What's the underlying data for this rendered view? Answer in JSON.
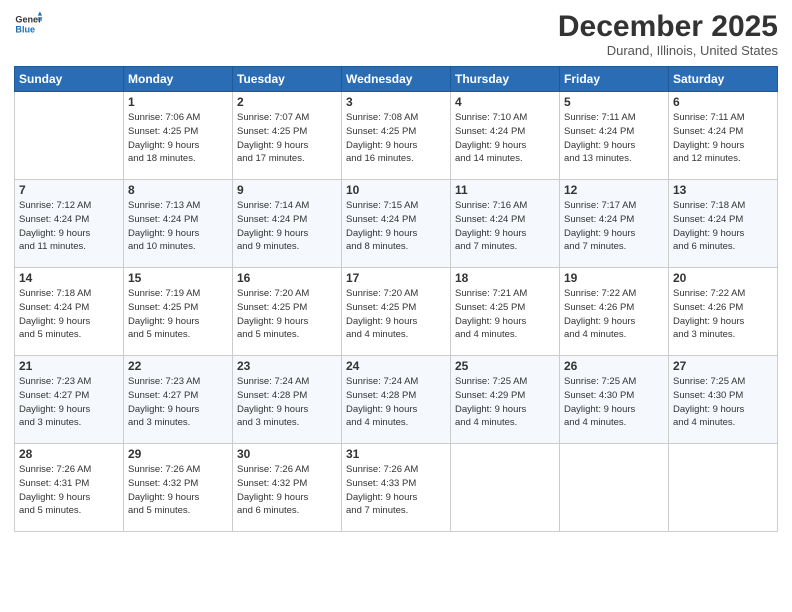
{
  "logo": {
    "general": "General",
    "blue": "Blue"
  },
  "header": {
    "title": "December 2025",
    "location": "Durand, Illinois, United States"
  },
  "weekdays": [
    "Sunday",
    "Monday",
    "Tuesday",
    "Wednesday",
    "Thursday",
    "Friday",
    "Saturday"
  ],
  "weeks": [
    [
      {
        "day": "",
        "info": ""
      },
      {
        "day": "1",
        "info": "Sunrise: 7:06 AM\nSunset: 4:25 PM\nDaylight: 9 hours\nand 18 minutes."
      },
      {
        "day": "2",
        "info": "Sunrise: 7:07 AM\nSunset: 4:25 PM\nDaylight: 9 hours\nand 17 minutes."
      },
      {
        "day": "3",
        "info": "Sunrise: 7:08 AM\nSunset: 4:25 PM\nDaylight: 9 hours\nand 16 minutes."
      },
      {
        "day": "4",
        "info": "Sunrise: 7:10 AM\nSunset: 4:24 PM\nDaylight: 9 hours\nand 14 minutes."
      },
      {
        "day": "5",
        "info": "Sunrise: 7:11 AM\nSunset: 4:24 PM\nDaylight: 9 hours\nand 13 minutes."
      },
      {
        "day": "6",
        "info": "Sunrise: 7:11 AM\nSunset: 4:24 PM\nDaylight: 9 hours\nand 12 minutes."
      }
    ],
    [
      {
        "day": "7",
        "info": "Sunrise: 7:12 AM\nSunset: 4:24 PM\nDaylight: 9 hours\nand 11 minutes."
      },
      {
        "day": "8",
        "info": "Sunrise: 7:13 AM\nSunset: 4:24 PM\nDaylight: 9 hours\nand 10 minutes."
      },
      {
        "day": "9",
        "info": "Sunrise: 7:14 AM\nSunset: 4:24 PM\nDaylight: 9 hours\nand 9 minutes."
      },
      {
        "day": "10",
        "info": "Sunrise: 7:15 AM\nSunset: 4:24 PM\nDaylight: 9 hours\nand 8 minutes."
      },
      {
        "day": "11",
        "info": "Sunrise: 7:16 AM\nSunset: 4:24 PM\nDaylight: 9 hours\nand 7 minutes."
      },
      {
        "day": "12",
        "info": "Sunrise: 7:17 AM\nSunset: 4:24 PM\nDaylight: 9 hours\nand 7 minutes."
      },
      {
        "day": "13",
        "info": "Sunrise: 7:18 AM\nSunset: 4:24 PM\nDaylight: 9 hours\nand 6 minutes."
      }
    ],
    [
      {
        "day": "14",
        "info": "Sunrise: 7:18 AM\nSunset: 4:24 PM\nDaylight: 9 hours\nand 5 minutes."
      },
      {
        "day": "15",
        "info": "Sunrise: 7:19 AM\nSunset: 4:25 PM\nDaylight: 9 hours\nand 5 minutes."
      },
      {
        "day": "16",
        "info": "Sunrise: 7:20 AM\nSunset: 4:25 PM\nDaylight: 9 hours\nand 5 minutes."
      },
      {
        "day": "17",
        "info": "Sunrise: 7:20 AM\nSunset: 4:25 PM\nDaylight: 9 hours\nand 4 minutes."
      },
      {
        "day": "18",
        "info": "Sunrise: 7:21 AM\nSunset: 4:25 PM\nDaylight: 9 hours\nand 4 minutes."
      },
      {
        "day": "19",
        "info": "Sunrise: 7:22 AM\nSunset: 4:26 PM\nDaylight: 9 hours\nand 4 minutes."
      },
      {
        "day": "20",
        "info": "Sunrise: 7:22 AM\nSunset: 4:26 PM\nDaylight: 9 hours\nand 3 minutes."
      }
    ],
    [
      {
        "day": "21",
        "info": "Sunrise: 7:23 AM\nSunset: 4:27 PM\nDaylight: 9 hours\nand 3 minutes."
      },
      {
        "day": "22",
        "info": "Sunrise: 7:23 AM\nSunset: 4:27 PM\nDaylight: 9 hours\nand 3 minutes."
      },
      {
        "day": "23",
        "info": "Sunrise: 7:24 AM\nSunset: 4:28 PM\nDaylight: 9 hours\nand 3 minutes."
      },
      {
        "day": "24",
        "info": "Sunrise: 7:24 AM\nSunset: 4:28 PM\nDaylight: 9 hours\nand 4 minutes."
      },
      {
        "day": "25",
        "info": "Sunrise: 7:25 AM\nSunset: 4:29 PM\nDaylight: 9 hours\nand 4 minutes."
      },
      {
        "day": "26",
        "info": "Sunrise: 7:25 AM\nSunset: 4:30 PM\nDaylight: 9 hours\nand 4 minutes."
      },
      {
        "day": "27",
        "info": "Sunrise: 7:25 AM\nSunset: 4:30 PM\nDaylight: 9 hours\nand 4 minutes."
      }
    ],
    [
      {
        "day": "28",
        "info": "Sunrise: 7:26 AM\nSunset: 4:31 PM\nDaylight: 9 hours\nand 5 minutes."
      },
      {
        "day": "29",
        "info": "Sunrise: 7:26 AM\nSunset: 4:32 PM\nDaylight: 9 hours\nand 5 minutes."
      },
      {
        "day": "30",
        "info": "Sunrise: 7:26 AM\nSunset: 4:32 PM\nDaylight: 9 hours\nand 6 minutes."
      },
      {
        "day": "31",
        "info": "Sunrise: 7:26 AM\nSunset: 4:33 PM\nDaylight: 9 hours\nand 7 minutes."
      },
      {
        "day": "",
        "info": ""
      },
      {
        "day": "",
        "info": ""
      },
      {
        "day": "",
        "info": ""
      }
    ]
  ]
}
